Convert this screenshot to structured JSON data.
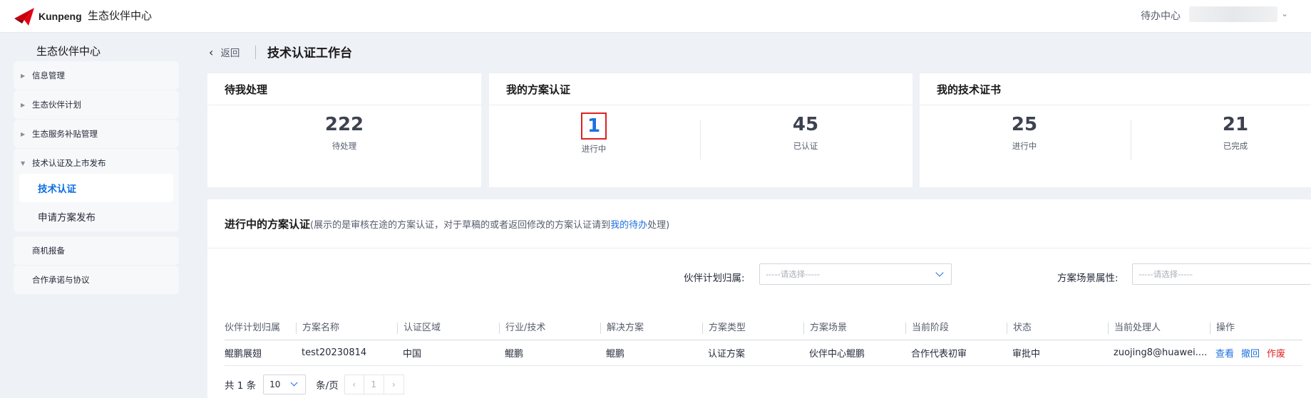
{
  "header": {
    "logo_text": "Kunpeng",
    "site_title": "生态伙伴中心",
    "todo_center": "待办中心"
  },
  "sidebar": {
    "title": "生态伙伴中心",
    "groups": [
      {
        "label": "信息管理",
        "expanded": false
      },
      {
        "label": "生态伙伴计划",
        "expanded": false
      },
      {
        "label": "生态服务补贴管理",
        "expanded": false
      },
      {
        "label": "技术认证及上市发布",
        "expanded": true,
        "children": [
          "技术认证",
          "申请方案发布"
        ],
        "active_child": "技术认证"
      },
      {
        "label": "商机报备"
      },
      {
        "label": "合作承诺与协议"
      }
    ]
  },
  "page": {
    "back_label": "返回",
    "title": "技术认证工作台"
  },
  "cards": {
    "pending": {
      "title": "待我处理",
      "value": "222",
      "label": "待处理"
    },
    "solution": {
      "title": "我的方案认证",
      "in_progress_value": "1",
      "in_progress_label": "进行中",
      "certified_value": "45",
      "certified_label": "已认证"
    },
    "cert": {
      "title": "我的技术证书",
      "in_progress_value": "25",
      "in_progress_label": "进行中",
      "done_value": "21",
      "done_label": "已完成"
    }
  },
  "panel": {
    "title": "进行中的方案认证",
    "desc_prefix": "(展示的是审核在途的方案认证，对于草稿的或者返回修改的方案认证请到",
    "desc_link": "我的待办",
    "desc_suffix": "处理)",
    "filter1_label": "伙伴计划归属:",
    "filter1_placeholder": "-----请选择-----",
    "filter2_label": "方案场景属性:",
    "filter2_placeholder": "-----请选择-----"
  },
  "table": {
    "headers": [
      "伙伴计划归属",
      "方案名称",
      "认证区域",
      "行业/技术",
      "解决方案",
      "方案类型",
      "方案场景",
      "当前阶段",
      "状态",
      "当前处理人",
      "操作"
    ],
    "rows": [
      [
        "鲲鹏展翅",
        "test20230814",
        "中国",
        "鲲鹏",
        "鲲鹏",
        "认证方案",
        "伙伴中心鲲鹏",
        "合作代表初审",
        "审批中",
        "zuojing8@huawei...."
      ]
    ],
    "actions": {
      "view": "查看",
      "withdraw": "撤回",
      "void": "作废"
    }
  },
  "pager": {
    "total": "共 1 条",
    "page_size": "10",
    "unit": "条/页",
    "prev": "‹",
    "current": "1",
    "next": "›"
  },
  "colors": {
    "accent": "#1e6fe1",
    "danger": "#e02020"
  }
}
